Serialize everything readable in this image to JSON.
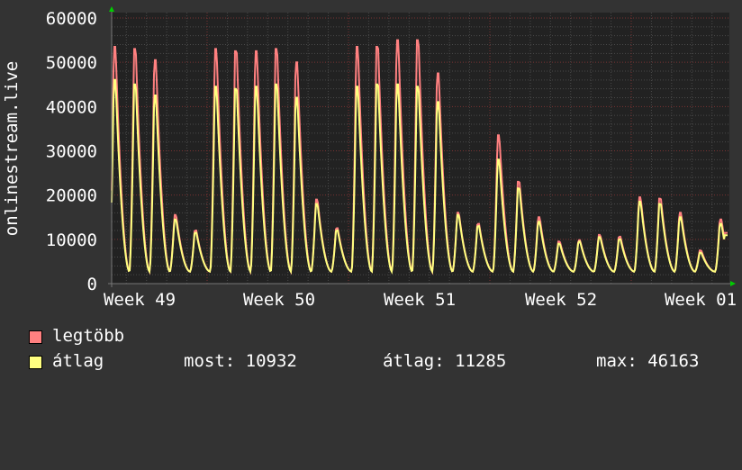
{
  "chart_data": {
    "type": "line",
    "ylabel": "onlinestream.live",
    "ylim": [
      0,
      60000
    ],
    "yticks": [
      "0",
      "10000",
      "20000",
      "30000",
      "40000",
      "50000",
      "60000"
    ],
    "xticks": [
      "Week 49",
      "Week 50",
      "Week 51",
      "Week 52",
      "Week 01"
    ],
    "grid": true,
    "background": "#333333",
    "plot_background": "#222222",
    "daily_trough": 2700,
    "series": [
      {
        "name": "legtöbb",
        "color": "#ff8080",
        "daily_peaks": [
          53500,
          53000,
          50500,
          15500,
          12000,
          53000,
          52500,
          52500,
          53000,
          50000,
          19000,
          12500,
          53500,
          53500,
          55000,
          55000,
          47500,
          16000,
          13500,
          33500,
          23000,
          15000,
          9500,
          9800,
          11000,
          10600,
          19500,
          19200,
          16000,
          7500,
          14500
        ]
      },
      {
        "name": "átlag",
        "color": "#ffff80",
        "daily_peaks": [
          46000,
          45000,
          42500,
          14500,
          11500,
          44500,
          44000,
          44500,
          45000,
          42000,
          18000,
          12000,
          44500,
          45000,
          45000,
          44500,
          41000,
          15500,
          13000,
          28000,
          21500,
          14000,
          9000,
          9500,
          10500,
          10000,
          18500,
          18000,
          15000,
          7000,
          13500
        ],
        "last": 10932
      }
    ]
  },
  "legend": {
    "items": [
      {
        "label": "legtöbb",
        "color": "#ff8080"
      },
      {
        "label": "átlag",
        "color": "#ffff80"
      }
    ],
    "stats": {
      "most": "most: 10932",
      "atlag": "átlag: 11285",
      "max": "max: 46163"
    }
  }
}
